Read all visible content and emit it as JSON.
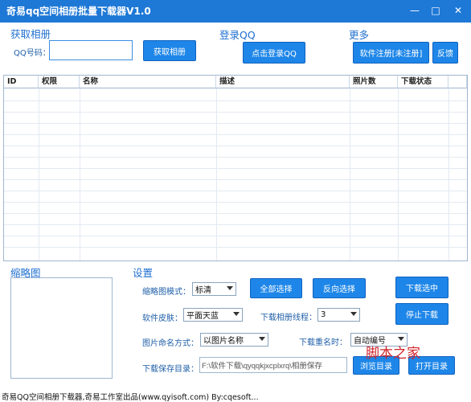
{
  "window": {
    "title": "奇易qq空间相册批量下载器V1.0",
    "min": "—",
    "max": "□",
    "close": "✕"
  },
  "fetch": {
    "section": "获取相册",
    "qq_label": "QQ号码：",
    "qq_value": "",
    "button": "获取相册"
  },
  "login": {
    "section": "登录QQ",
    "button": "点击登录QQ"
  },
  "more": {
    "section": "更多",
    "register": "软件注册[未注册]",
    "feedback": "反馈"
  },
  "table": {
    "columns": [
      "ID",
      "权限",
      "名称",
      "描述",
      "照片数",
      "下载状态"
    ],
    "rows": []
  },
  "thumb": {
    "section": "缩略图"
  },
  "settings": {
    "section": "设置",
    "thumb_mode_label": "缩略图模式：",
    "thumb_mode_value": "标清",
    "skin_label": "软件皮肤：",
    "skin_value": "平面天蓝",
    "threads_label": "下载相册线程：",
    "threads_value": "3",
    "naming_label": "图片命名方式：",
    "naming_value": "以图片名称",
    "rename_label": "下载重名时：",
    "rename_value": "自动编号",
    "dir_label": "下载保存目录：",
    "dir_value": "F:\\软件下载\\qyqqkjxcplxrq\\相册保存",
    "select_all": "全部选择",
    "invert": "反向选择",
    "download_selected": "下载选中",
    "stop": "停止下载",
    "open_dir_1": "浏览目录",
    "open_dir_2": "打开目录"
  },
  "status": "奇易QQ空间相册下载器,奇易工作室出品(www.qyisoft.com) By:cqesoft...",
  "watermark": "脚本之家"
}
